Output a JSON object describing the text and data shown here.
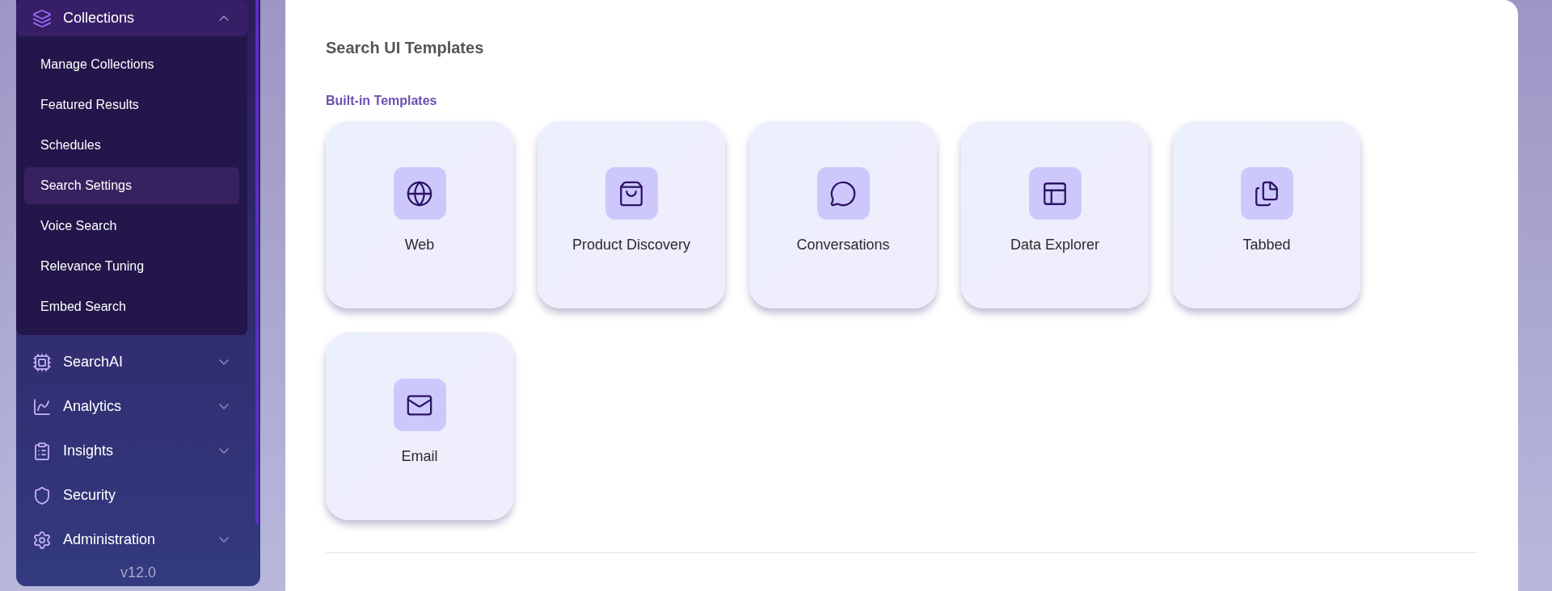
{
  "sidebar": {
    "items": [
      {
        "label": "Collections",
        "expanded": true,
        "children": [
          {
            "label": "Manage Collections",
            "selected": false
          },
          {
            "label": "Featured Results",
            "selected": false
          },
          {
            "label": "Schedules",
            "selected": false
          },
          {
            "label": "Search Settings",
            "selected": true
          },
          {
            "label": "Voice Search",
            "selected": false
          },
          {
            "label": "Relevance Tuning",
            "selected": false
          },
          {
            "label": "Embed Search",
            "selected": false
          }
        ]
      },
      {
        "label": "SearchAI",
        "expanded": false
      },
      {
        "label": "Analytics",
        "expanded": false
      },
      {
        "label": "Insights",
        "expanded": false
      },
      {
        "label": "Security"
      },
      {
        "label": "Administration",
        "expanded": false
      }
    ],
    "version": "v12.0"
  },
  "main": {
    "title": "Search UI Templates",
    "section": "Built-in Templates",
    "templates": [
      {
        "label": "Web"
      },
      {
        "label": "Product Discovery"
      },
      {
        "label": "Conversations"
      },
      {
        "label": "Data Explorer"
      },
      {
        "label": "Tabbed"
      },
      {
        "label": "Email"
      }
    ]
  }
}
